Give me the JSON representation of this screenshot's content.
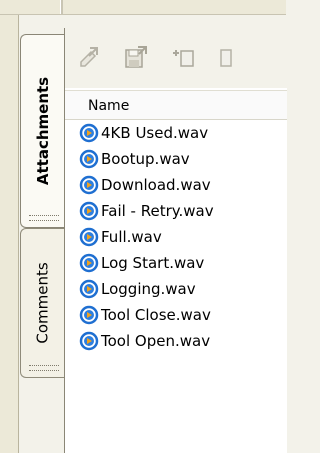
{
  "tabs": [
    {
      "label": "Attachments",
      "active": true
    },
    {
      "label": "Comments",
      "active": false
    }
  ],
  "toolbar": {
    "buttons": [
      {
        "name": "open-attachment",
        "icon": "open-icon"
      },
      {
        "name": "save-attachment",
        "icon": "save-icon"
      },
      {
        "name": "add-attachment",
        "icon": "add-icon"
      },
      {
        "name": "delete-attachment",
        "icon": "delete-icon"
      }
    ]
  },
  "list": {
    "column_header": "Name",
    "files": [
      "4KB Used.wav",
      "Bootup.wav",
      "Download.wav",
      "Fail - Retry.wav",
      "Full.wav",
      "Log Start.wav",
      "Logging.wav",
      "Tool Close.wav",
      "Tool Open.wav"
    ]
  },
  "colors": {
    "tab_border": "#8a8676",
    "icon_blue": "#1f6fd1",
    "icon_orange": "#f2a21c"
  }
}
